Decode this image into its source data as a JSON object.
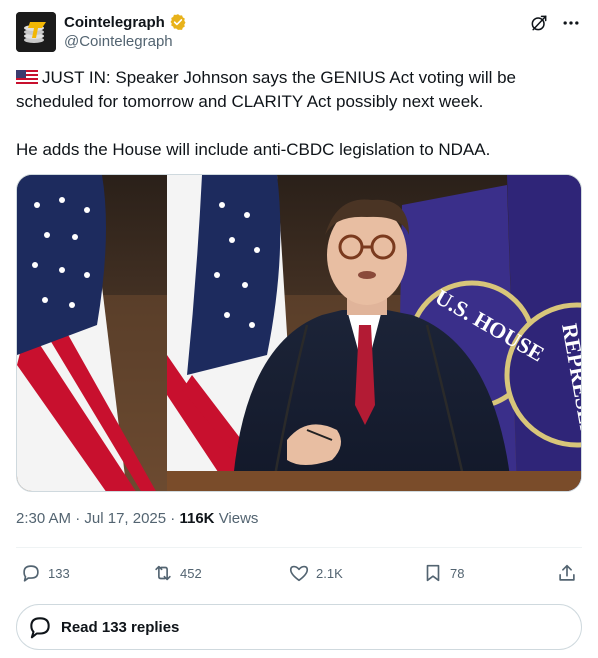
{
  "author": {
    "display_name": "Cointelegraph",
    "handle": "@Cointelegraph",
    "verified_badge_color": "#e8b21a"
  },
  "tweet": {
    "line1": "JUST IN: Speaker Johnson says the GENIUS Act voting will be scheduled for tomorrow and CLARITY Act possibly next week.",
    "line2": "He adds the House will include anti-CBDC legislation to NDAA."
  },
  "media": {
    "seal_text_1": "U.S. HOUSE",
    "seal_text_2": "REPRESEN"
  },
  "meta": {
    "time": "2:30 AM",
    "date": "Jul 17, 2025",
    "views_count": "116K",
    "views_label": "Views"
  },
  "actions": {
    "replies": "133",
    "reposts": "452",
    "likes": "2.1K",
    "bookmarks": "78"
  },
  "read_replies_label": "Read 133 replies",
  "colors": {
    "text_primary": "#0f1419",
    "text_secondary": "#536471",
    "border": "#cfd9de"
  }
}
